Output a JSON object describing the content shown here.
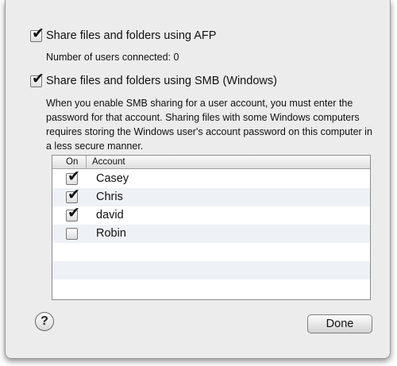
{
  "afp": {
    "label": "Share files and folders using AFP",
    "checked": true,
    "status": "Number of users connected: 0"
  },
  "smb": {
    "label": "Share files and folders using SMB (Windows)",
    "checked": true,
    "description": "When you enable SMB sharing for a user account, you must enter the password for that account. Sharing files with some Windows computers requires storing the Windows user's account password on this computer in a less secure manner."
  },
  "table": {
    "columns": [
      "On",
      "Account"
    ],
    "rows": [
      {
        "name": "Casey",
        "on": true
      },
      {
        "name": "Chris",
        "on": true
      },
      {
        "name": "david",
        "on": true
      },
      {
        "name": "Robin",
        "on": false
      }
    ]
  },
  "buttons": {
    "help": "?",
    "done": "Done"
  },
  "icons": {
    "check": "✔",
    "help": "question-mark-icon"
  }
}
